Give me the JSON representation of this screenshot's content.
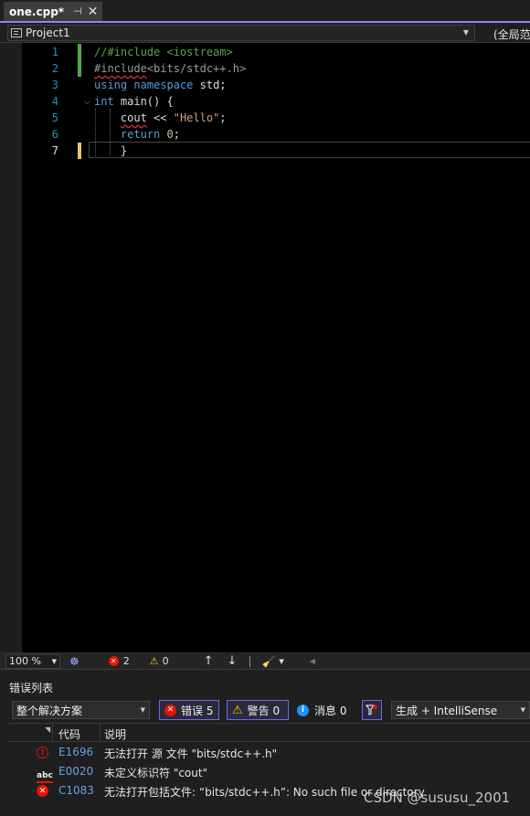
{
  "tab": {
    "title": "one.cpp*",
    "pin_glyph": "⊣",
    "close_glyph": "✕"
  },
  "navbar": {
    "project": "Project1",
    "scope": "(全局范"
  },
  "editor": {
    "line_numbers": [
      "1",
      "2",
      "3",
      "4",
      "5",
      "6",
      "7"
    ],
    "current_line": 7,
    "lines": [
      [
        {
          "t": "//#include <iostream>",
          "c": "comment"
        }
      ],
      [
        {
          "t": "#include",
          "c": "pre",
          "s": true
        },
        {
          "t": "<bits/stdc++.h>",
          "c": "pre"
        }
      ],
      [
        {
          "t": "using",
          "c": "kw"
        },
        {
          "t": " ",
          "c": "txt"
        },
        {
          "t": "namespace",
          "c": "kw"
        },
        {
          "t": " std;",
          "c": "txt"
        }
      ],
      [
        {
          "t": "int",
          "c": "kw"
        },
        {
          "t": " main() {",
          "c": "txt"
        }
      ],
      [
        {
          "t": "    ",
          "c": "txt"
        },
        {
          "t": "cout",
          "c": "txt",
          "s": true
        },
        {
          "t": " << ",
          "c": "txt"
        },
        {
          "t": "\"Hello\"",
          "c": "str"
        },
        {
          "t": ";",
          "c": "txt"
        }
      ],
      [
        {
          "t": "    ",
          "c": "txt"
        },
        {
          "t": "return",
          "c": "kw"
        },
        {
          "t": " ",
          "c": "txt"
        },
        {
          "t": "0",
          "c": "num"
        },
        {
          "t": ";",
          "c": "txt"
        }
      ],
      [
        {
          "t": "    }",
          "c": "txt"
        }
      ]
    ]
  },
  "status_strip": {
    "zoom": "100 %",
    "error_count": "2",
    "warning_count": "0"
  },
  "error_list": {
    "title": "错误列表",
    "scope_filter": "整个解决方案",
    "errors_button": "错误 5",
    "warnings_button": "警告 0",
    "messages_button": "消息 0",
    "source_filter": "生成 + IntelliSense",
    "columns": {
      "code": "代码",
      "description": "说明"
    },
    "rows": [
      {
        "icon": "error-outline-icon",
        "code": "E1696",
        "description": "无法打开 源 文件 \"bits/stdc++.h\""
      },
      {
        "icon": "spelling-error-icon",
        "code": "E0020",
        "description": "未定义标识符 \"cout\""
      },
      {
        "icon": "error-icon",
        "code": "C1083",
        "description": "无法打开包括文件: “bits/stdc++.h”: No such file or directory"
      }
    ]
  },
  "watermark": "CSDN @sususu_2001",
  "colors": {
    "accent": "#9184ee",
    "line_number": "#2b91af",
    "comment": "#57a64a",
    "keyword": "#569cd6",
    "string": "#d69d85",
    "error": "#e51400",
    "warning": "#f5c400",
    "info": "#1e90ff"
  }
}
